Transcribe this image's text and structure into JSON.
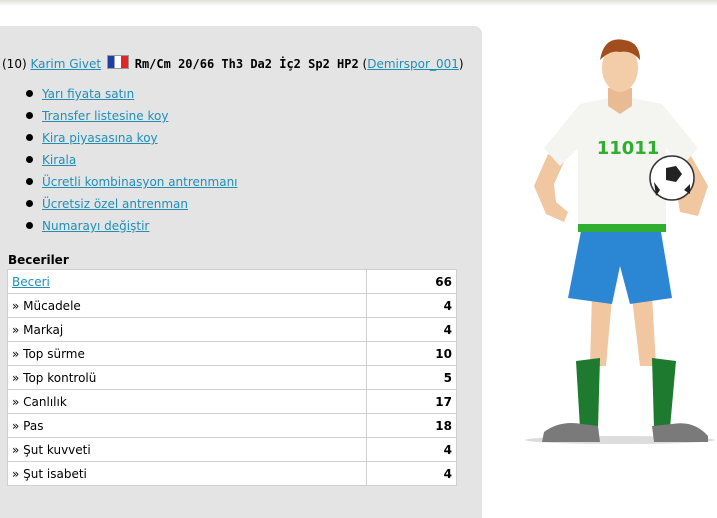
{
  "player": {
    "number": "(10)",
    "name": "Karim Givet",
    "stats": "Rm/Cm 20/66 Th3 Da2 İç2 Sp2 HP2",
    "team_open": "(",
    "team": "Demirspor_001",
    "team_close": ")"
  },
  "actions": [
    "Yarı fiyata satın",
    "Transfer listesine koy",
    "Kira piyasasına koy",
    "Kirala",
    "Ücretli kombinasyon antrenmanı",
    "Ücretsiz özel antrenman",
    "Numarayı değiştir"
  ],
  "skills": {
    "title": "Beceriler",
    "rows": [
      {
        "label": "Beceri",
        "value": "66"
      },
      {
        "label": "» Mücadele",
        "value": "4"
      },
      {
        "label": "» Markaj",
        "value": "4"
      },
      {
        "label": "» Top sürme",
        "value": "10"
      },
      {
        "label": "» Top kontrolü",
        "value": "5"
      },
      {
        "label": "» Canlılık",
        "value": "17"
      },
      {
        "label": "» Pas",
        "value": "18"
      },
      {
        "label": "» Şut kuvveti",
        "value": "4"
      },
      {
        "label": "» Şut isabeti",
        "value": "4"
      }
    ]
  },
  "figure": {
    "logo_text": "11011",
    "shirt_color": "#f4f4f0",
    "trim_color": "#2fae2f",
    "shorts_color": "#2b86d4",
    "socks_color": "#1e7a2e"
  }
}
